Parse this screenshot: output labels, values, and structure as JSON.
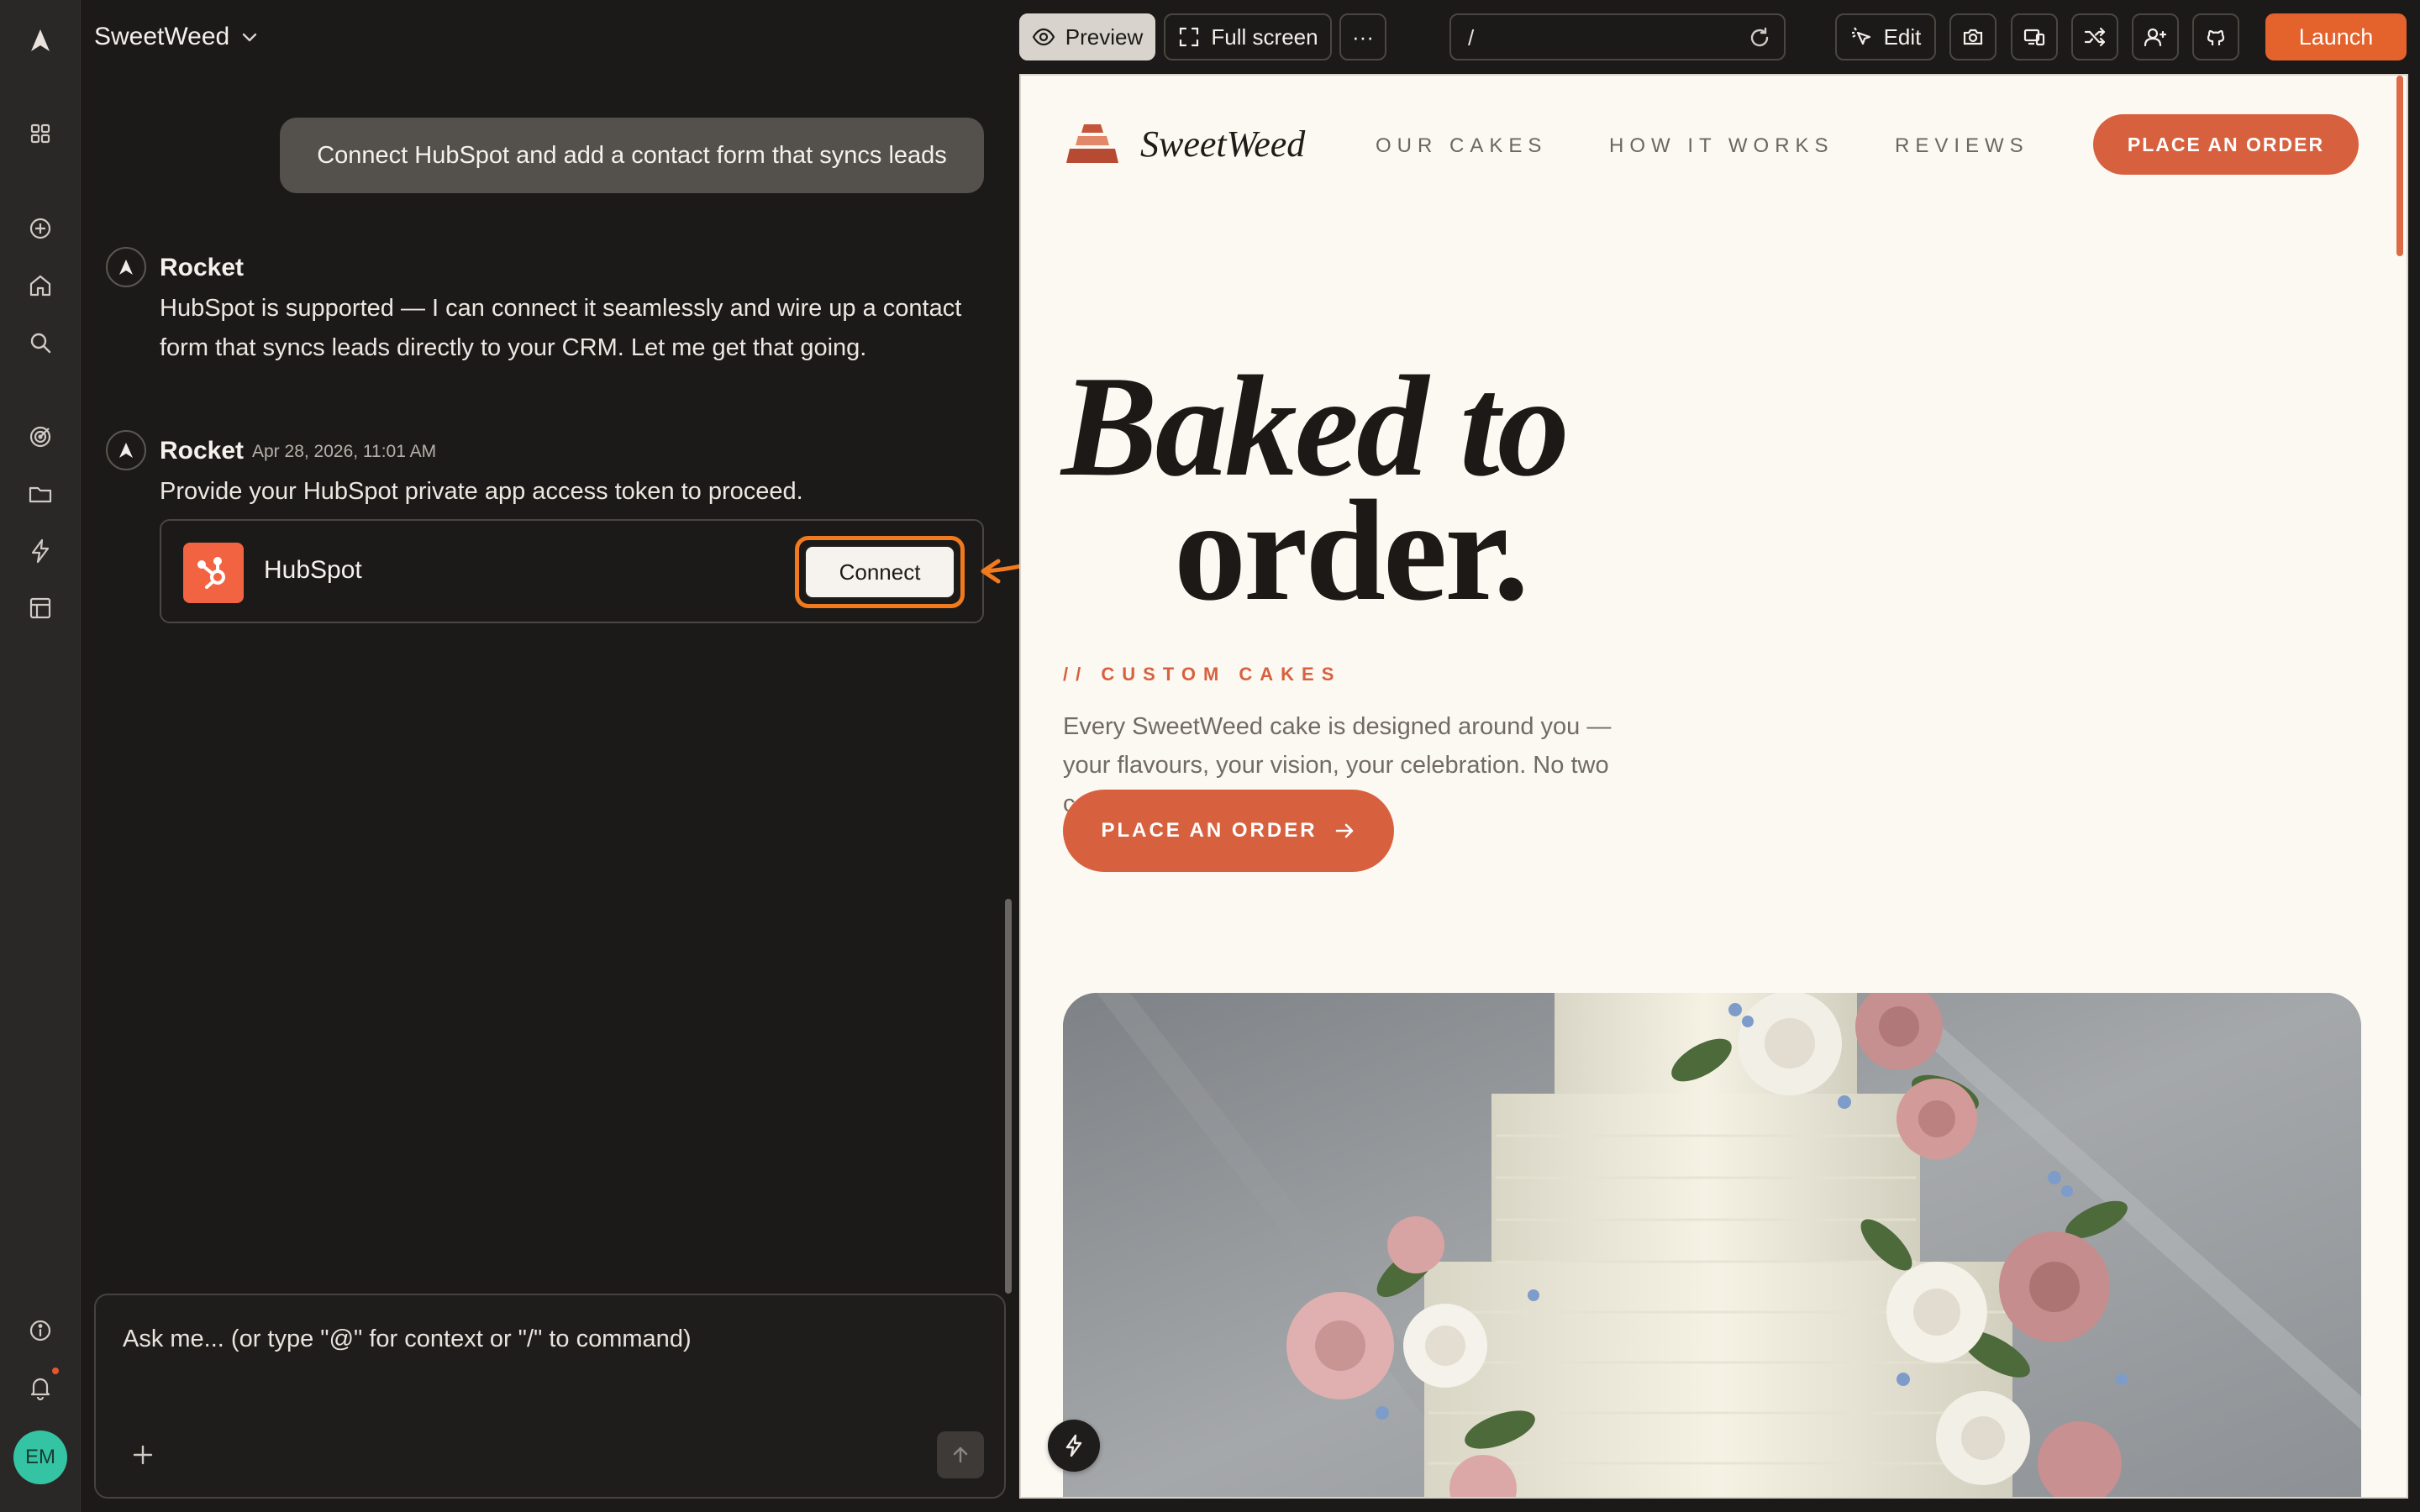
{
  "project": {
    "name": "SweetWeed"
  },
  "chat": {
    "user_message": "Connect HubSpot and add a contact form that syncs leads",
    "messages": [
      {
        "sender": "Rocket",
        "timestamp": "",
        "text_lines": [
          "HubSpot is supported — I can connect it seamlessly and wire up a contact",
          "form that syncs leads directly to your CRM. Let me get that going."
        ]
      },
      {
        "sender": "Rocket",
        "timestamp": "Apr 28, 2026, 11:01 AM",
        "text_lines": [
          "Provide your HubSpot private app access token to proceed."
        ]
      }
    ],
    "integration": {
      "name": "HubSpot",
      "button_label": "Connect"
    },
    "composer": {
      "placeholder": "Ask me... (or type \"@\" for context or \"/\" to command)"
    }
  },
  "rail": {
    "icons": [
      "rocket-logo-icon",
      "grid-icon",
      "plus-circle-icon",
      "home-icon",
      "search-icon",
      "target-icon",
      "folder-icon",
      "bolt-icon",
      "layout-icon",
      "info-icon",
      "bell-icon"
    ],
    "avatar_initials": "EM"
  },
  "toolbar": {
    "preview_label": "Preview",
    "fullscreen_label": "Full screen",
    "more_label": "···",
    "url": "/",
    "edit_label": "Edit",
    "launch_label": "Launch"
  },
  "site": {
    "brand": "SweetWeed",
    "nav": [
      "OUR CAKES",
      "HOW IT WORKS",
      "REVIEWS"
    ],
    "nav_cta": "PLACE AN ORDER",
    "hero_line1": "Baked to",
    "hero_line2": "order.",
    "eyebrow": "// CUSTOM CAKES",
    "description": "Every SweetWeed cake is designed around you — your flavours, your vision, your celebration. No two cakes are ever the same.",
    "hero_cta": "PLACE AN ORDER"
  },
  "colors": {
    "accent_orange": "#e4622c",
    "site_terracotta": "#d7613f",
    "hubspot_orange": "#f26441",
    "avatar_teal": "#34c4a3"
  }
}
